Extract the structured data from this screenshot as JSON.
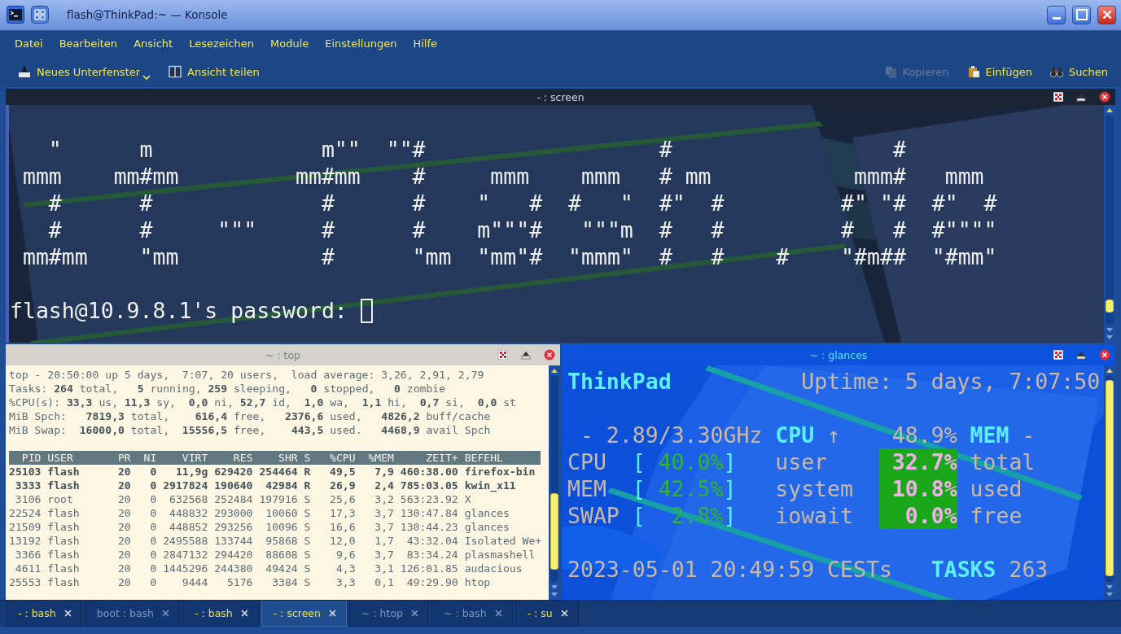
{
  "window": {
    "title": "flash@ThinkPad:~ — Konsole"
  },
  "menu": [
    "Datei",
    "Bearbeiten",
    "Ansicht",
    "Lesezeichen",
    "Module",
    "Einstellungen",
    "Hilfe"
  ],
  "toolbar": {
    "left": [
      {
        "label": "Neues Unterfenster",
        "kind": "new_tab",
        "has_menu": true,
        "disabled": false
      },
      {
        "label": "Ansicht teilen",
        "kind": "split",
        "has_menu": false,
        "disabled": false
      }
    ],
    "right": [
      {
        "label": "Kopieren",
        "kind": "copy",
        "has_menu": false,
        "disabled": true
      },
      {
        "label": "Einfügen",
        "kind": "paste",
        "has_menu": false,
        "disabled": false
      },
      {
        "label": "Suchen",
        "kind": "find",
        "has_menu": false,
        "disabled": false
      }
    ]
  },
  "screen_pane": {
    "title": "- : screen",
    "banner": [
      "   \"      m             m\"\"  \"\"#                  #                 #",
      " mmm    mm#mm         mm#mm    #     mmm    mmm   # mm           mmm#   mmm",
      "   #      #             #      #    \"   #  #   \"  #\"  #         #\" \"#  #\"  #",
      "   #      #     \"\"\"     #      #    m\"\"\"#   \"\"\"m  #   #         #   #  #\"\"\"\"",
      " mm#mm    \"mm           #      \"mm  \"mm\"#  \"mmm\"  #   #    #    \"#m##  \"#mm\""
    ],
    "prompt": "flash@10.9.8.1's password:"
  },
  "top_pane": {
    "title": "~ : top",
    "summary": [
      "top - 20:50:00 up 5 days,  7:07, 20 users,  load average: 3,26, 2,91, 2,79",
      "Tasks: **264** total,   **5** running, **259** sleeping,   **0** stopped,   **0** zombie",
      "%CPU(s): **33,3** us, **11,3** sy,  **0,0** ni, **52,7** id,  **1,0** wa,  **1,1** hi,  **0,7** si,  **0,0** st",
      "MiB Spch:   **7819,3** total,    **616,4** free,   **2376,6** used,   **4826,2** buff/cache",
      "MiB Swap:  **16000,0** total,  **15556,5** free,    **443,5** used.   **4468,9** avail Spch"
    ],
    "columns": [
      "PID",
      "USER",
      "PR",
      "NI",
      "VIRT",
      "RES",
      "SHR",
      "S",
      "%CPU",
      "%MEM",
      "ZEIT+",
      "BEFEHL"
    ],
    "processes": [
      {
        "cells": [
          "25103",
          "flash",
          "20",
          "0",
          "11,9g",
          "629420",
          "254464",
          "R",
          "49,5",
          "7,9",
          "460:38.00",
          "firefox-bin"
        ],
        "highlighted": true
      },
      {
        "cells": [
          "3333",
          "flash",
          "20",
          "0",
          "2917824",
          "190640",
          "42984",
          "R",
          "26,9",
          "2,4",
          "785:03.05",
          "kwin_x11"
        ],
        "highlighted": true
      },
      {
        "cells": [
          "3106",
          "root",
          "20",
          "0",
          "632568",
          "252484",
          "197916",
          "S",
          "25,6",
          "3,2",
          "563:23.92",
          "X"
        ],
        "highlighted": false
      },
      {
        "cells": [
          "22524",
          "flash",
          "20",
          "0",
          "448832",
          "293000",
          "10060",
          "S",
          "17,3",
          "3,7",
          "130:47.84",
          "glances"
        ],
        "highlighted": false
      },
      {
        "cells": [
          "21509",
          "flash",
          "20",
          "0",
          "448852",
          "293256",
          "10096",
          "S",
          "16,6",
          "3,7",
          "130:44.23",
          "glances"
        ],
        "highlighted": false
      },
      {
        "cells": [
          "13192",
          "flash",
          "20",
          "0",
          "2495588",
          "133744",
          "95868",
          "S",
          "12,0",
          "1,7",
          "43:32.04",
          "Isolated We+"
        ],
        "highlighted": false
      },
      {
        "cells": [
          "3366",
          "flash",
          "20",
          "0",
          "2847132",
          "294420",
          "88608",
          "S",
          "9,6",
          "3,7",
          "83:34.24",
          "plasmashell"
        ],
        "highlighted": false
      },
      {
        "cells": [
          "4611",
          "flash",
          "20",
          "0",
          "1445296",
          "244380",
          "49424",
          "S",
          "4,3",
          "3,1",
          "126:01.85",
          "audacious"
        ],
        "highlighted": false
      },
      {
        "cells": [
          "25553",
          "flash",
          "20",
          "0",
          "9444",
          "5176",
          "3384",
          "S",
          "3,3",
          "0,1",
          "49:29.90",
          "htop"
        ],
        "highlighted": false
      }
    ]
  },
  "glances_pane": {
    "title": "~ : glances",
    "hostname": "ThinkPad",
    "uptime": "Uptime: 5 days, 7:07:50",
    "cpu_frequency": "- 2.89/3.30GHz",
    "cpu_label": "CPU",
    "cpu_arrow": "↑",
    "cpu_total": "48.9%",
    "mem_label": "MEM",
    "mem_dash": "-",
    "rows": [
      {
        "label": "CPU",
        "bracket_open": "[",
        "value": "40.0%",
        "bracket_close": "]",
        "stat_name": "user",
        "stat_value": "32.7%",
        "mem_name": "total"
      },
      {
        "label": "MEM",
        "bracket_open": "[",
        "value": "42.5%",
        "bracket_close": "]",
        "stat_name": "system",
        "stat_value": "10.8%",
        "mem_name": "used"
      },
      {
        "label": "SWAP",
        "bracket_open": "[",
        "value": "2.8%",
        "bracket_close": "]",
        "stat_name": "iowait",
        "stat_value": "0.0%",
        "mem_name": "free"
      }
    ],
    "datetime": "2023-05-01 20:49:59 CESTs",
    "tasks_label": "TASKS",
    "tasks_count": "263"
  },
  "tabs": [
    {
      "label": "- : bash",
      "selected": false,
      "dimmed": false
    },
    {
      "label": "boot : bash",
      "selected": false,
      "dimmed": true
    },
    {
      "label": "- : bash",
      "selected": false,
      "dimmed": false
    },
    {
      "label": "- : screen",
      "selected": true,
      "dimmed": false
    },
    {
      "label": "~ : htop",
      "selected": false,
      "dimmed": true
    },
    {
      "label": "~ : bash",
      "selected": false,
      "dimmed": true
    },
    {
      "label": "- : su",
      "selected": false,
      "dimmed": false
    }
  ]
}
